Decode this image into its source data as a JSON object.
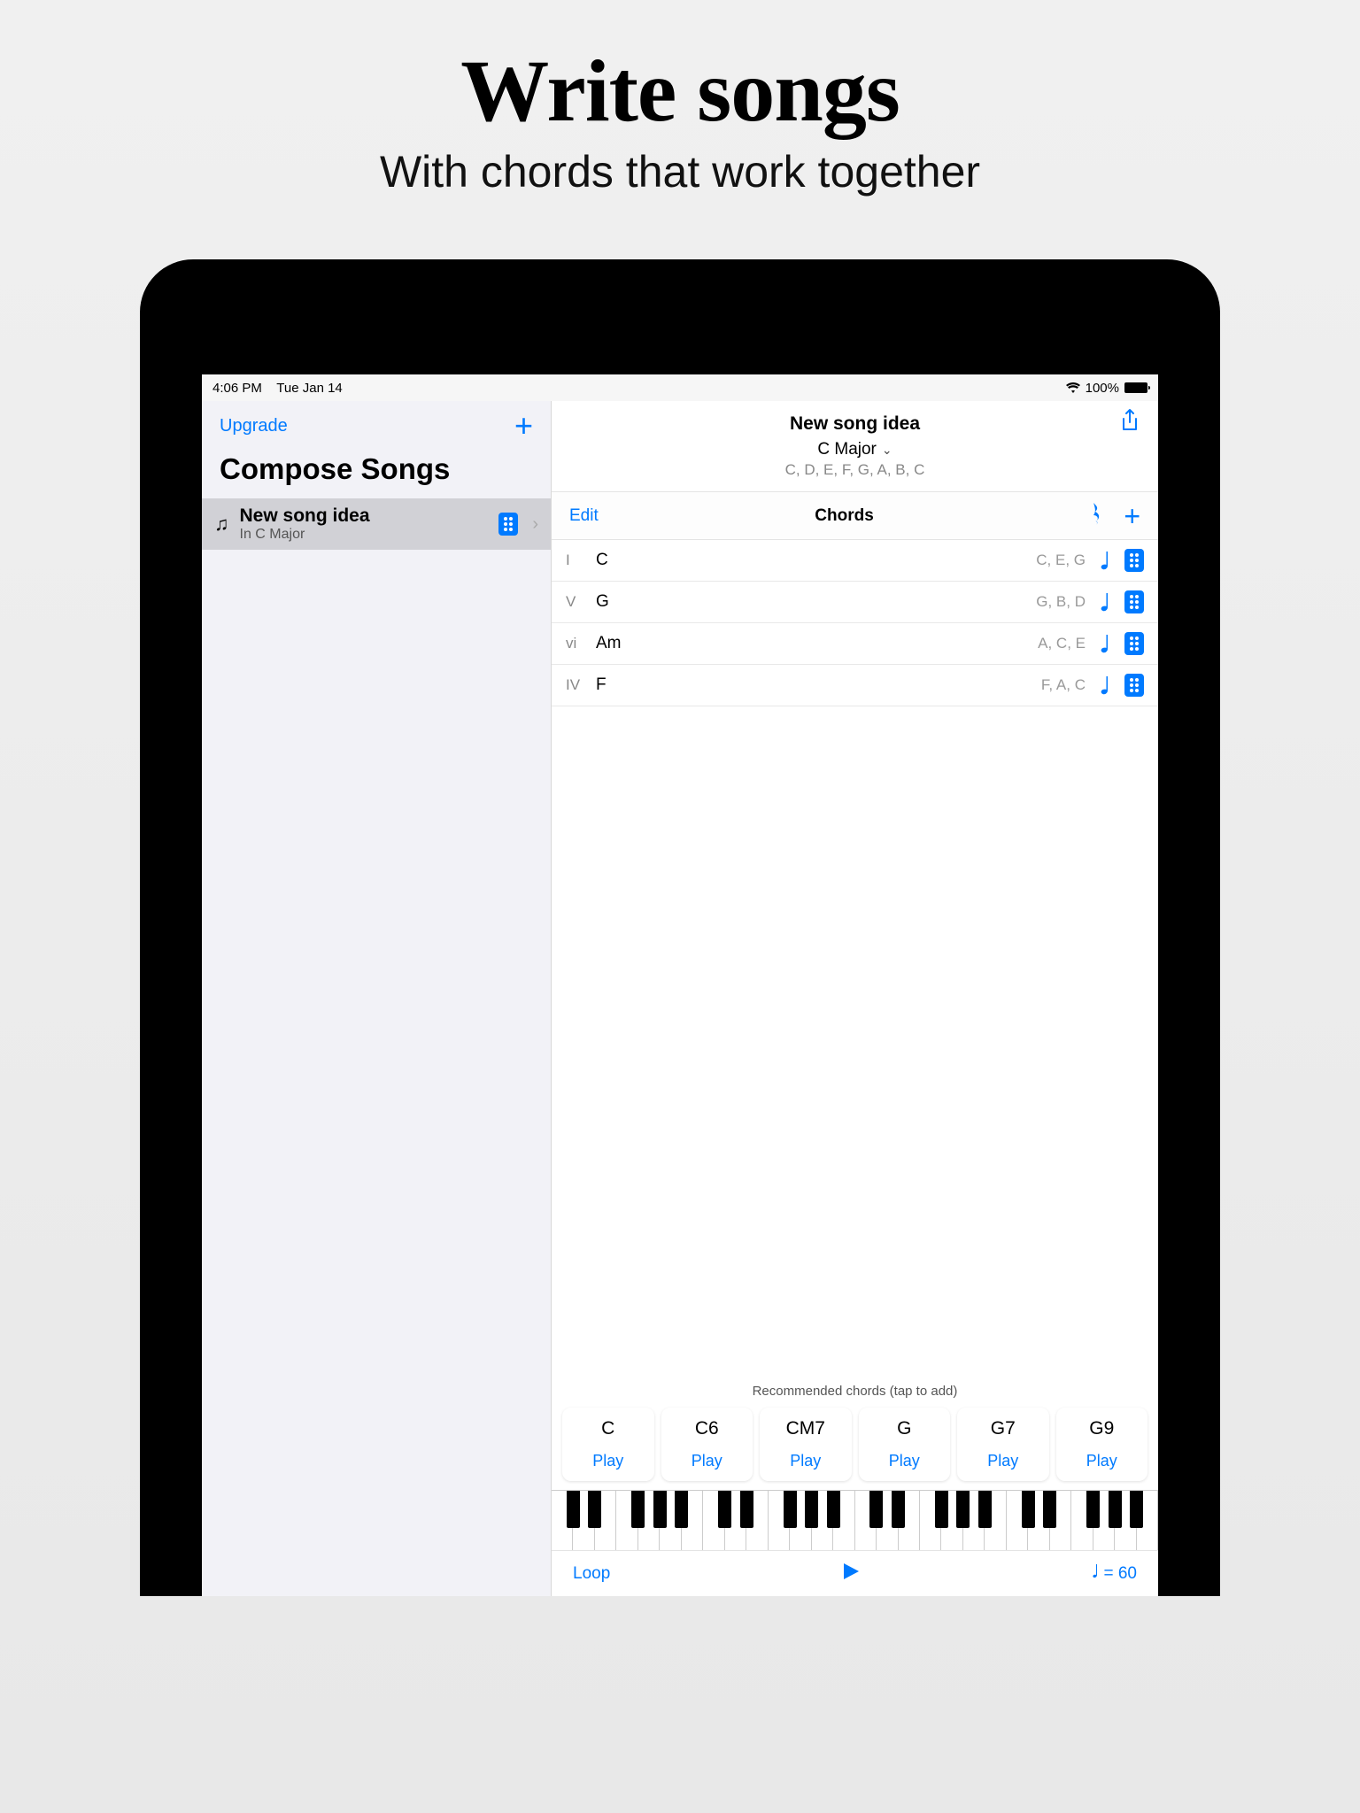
{
  "hero": {
    "title": "Write songs",
    "subtitle": "With chords that work together"
  },
  "status": {
    "time": "4:06 PM",
    "date": "Tue Jan 14",
    "battery_pct": "100%"
  },
  "sidebar": {
    "upgrade_label": "Upgrade",
    "title": "Compose Songs",
    "song": {
      "title": "New song idea",
      "subtitle": "In C Major"
    }
  },
  "content": {
    "title": "New song idea",
    "key": "C Major",
    "scale_notes": "C, D, E, F, G, A, B, C",
    "edit_label": "Edit",
    "chords_title": "Chords"
  },
  "chords": [
    {
      "degree": "I",
      "name": "C",
      "notes": "C, E, G"
    },
    {
      "degree": "V",
      "name": "G",
      "notes": "G, B, D"
    },
    {
      "degree": "vi",
      "name": "Am",
      "notes": "A, C, E"
    },
    {
      "degree": "IV",
      "name": "F",
      "notes": "F, A, C"
    }
  ],
  "recommended": {
    "label": "Recommended chords (tap to add)",
    "play_label": "Play",
    "chips": [
      "C",
      "C6",
      "CM7",
      "G",
      "G7",
      "G9"
    ]
  },
  "bottom": {
    "loop_label": "Loop",
    "tempo_text": "= 60"
  }
}
